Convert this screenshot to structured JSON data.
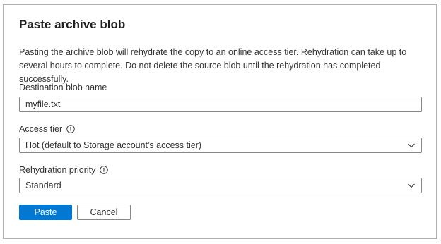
{
  "dialog": {
    "title": "Paste archive blob",
    "description": "Pasting the archive blob will rehydrate the copy to an online access tier. Rehydration can take up to several hours to complete. Do not delete the source blob until the rehydration has completed successfully."
  },
  "destination": {
    "label": "Destination blob name",
    "value": "myfile.txt"
  },
  "access_tier": {
    "label": "Access tier",
    "selected": "Hot (default to Storage account's access tier)",
    "info_icon": "info-icon",
    "chevron_icon": "chevron-down-icon"
  },
  "rehydration_priority": {
    "label": "Rehydration priority",
    "selected": "Standard",
    "info_icon": "info-icon",
    "chevron_icon": "chevron-down-icon"
  },
  "buttons": {
    "paste": "Paste",
    "cancel": "Cancel"
  },
  "colors": {
    "primary": "#0078d4",
    "border": "#8a8886",
    "text": "#323130"
  }
}
